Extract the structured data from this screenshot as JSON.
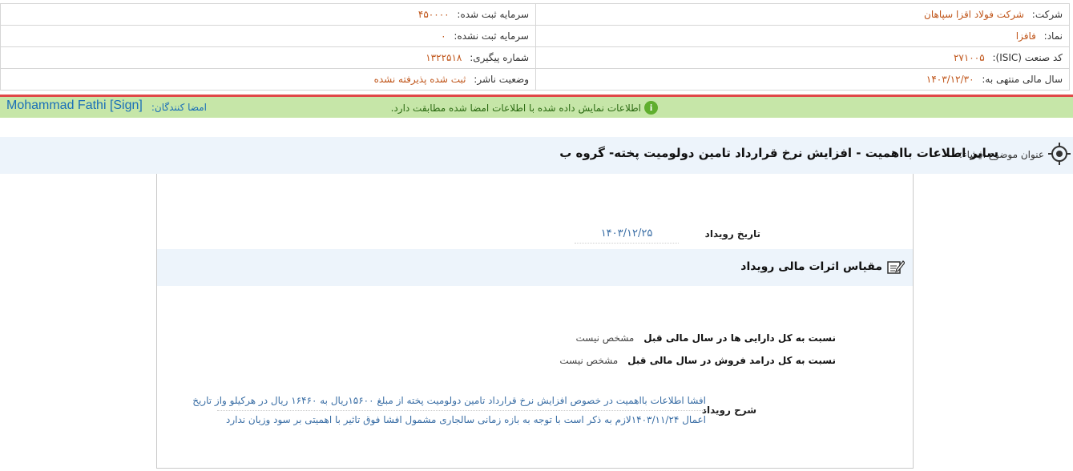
{
  "header": {
    "company_label": "شرکت:",
    "company_value": "شرکت فولاد اقزا سپاهان",
    "symbol_label": "نماد:",
    "symbol_value": "فافزا",
    "isic_label": "کد صنعت (ISIC):",
    "isic_value": "۲۷۱۰۰۵",
    "fiscal_label": "سال مالی منتهی به:",
    "fiscal_value": "۱۴۰۳/۱۲/۳۰",
    "capital_reg_label": "سرمایه ثبت شده:",
    "capital_reg_value": "۴۵۰۰۰۰",
    "capital_unreg_label": "سرمایه ثبت نشده:",
    "capital_unreg_value": "۰",
    "tracking_label": "شماره پیگیری:",
    "tracking_value": "۱۳۲۲۵۱۸",
    "publisher_status_label": "وضعیت ناشر:",
    "publisher_status_value": "ثبت شده پذیرفته نشده"
  },
  "signature_bar": {
    "signers_label": "امضا کنندگان:",
    "signer": "Mohammad Fathi [Sign]",
    "message": "اطلاعات نمایش داده شده با اطلاعات امضا شده مطابقت دارد.",
    "info_icon_text": "i"
  },
  "title_bar": {
    "label": "عنوان موضوع افشاء:",
    "title": "سایر اطلاعات بااهمیت - افزایش نرخ قرارداد تامین دولومیت پخته- گروه ب"
  },
  "event": {
    "date_label": "تاریخ رویداد",
    "date_value": "۱۴۰۳/۱۲/۲۵"
  },
  "section": {
    "title": "مقیاس اثرات مالی رویداد"
  },
  "ratios": {
    "assets_label": "نسبت به کل دارایی ها در سال مالی قبل",
    "assets_value": "مشخص نیست",
    "revenue_label": "نسبت به کل درامد فروش در سال مالی قبل",
    "revenue_value": "مشخص نیست"
  },
  "description": {
    "label": "شرح رویداد",
    "line1": "افشا اطلاعات بااهمیت در خصوص افزایش نرخ قرارداد تامین دولومیت پخته از مبلغ ۱۵۶۰۰ریال به ۱۶۴۶۰ ریال در هرکیلو واز تاریخ",
    "line2": "اعمال ۱۴۰۳/۱۱/۲۴لازم به ذکر است با توجه به بازه زمانی سالجاری مشمول افشا فوق تاثیر با اهمیتی بر سود وزیان ندارد"
  },
  "colors": {
    "accent_orange": "#c0561b",
    "link_blue": "#1a6fb8",
    "green_bar": "#c6e6a8",
    "red_line": "#e04848"
  }
}
